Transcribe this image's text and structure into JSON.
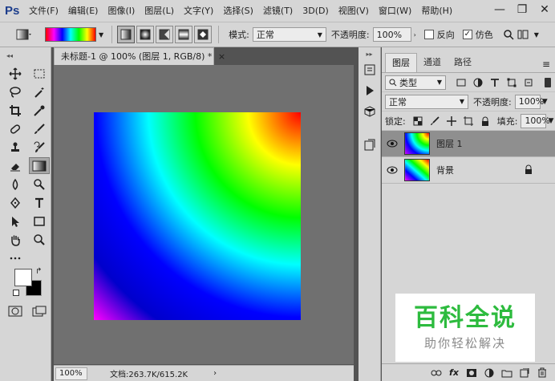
{
  "app": {
    "logo": "Ps"
  },
  "menu": [
    "文件(F)",
    "编辑(E)",
    "图像(I)",
    "图层(L)",
    "文字(Y)",
    "选择(S)",
    "滤镜(T)",
    "3D(D)",
    "视图(V)",
    "窗口(W)",
    "帮助(H)"
  ],
  "window_controls": {
    "minimize": "—",
    "restore": "❐",
    "close": "✕"
  },
  "options": {
    "mode_label": "模式:",
    "mode_value": "正常",
    "opacity_label": "不透明度:",
    "opacity_value": "100%",
    "reverse_label": "反向",
    "reverse_checked": false,
    "dither_label": "仿色",
    "dither_checked": true
  },
  "document": {
    "tab_title": "未标题-1 @ 100% (图层 1, RGB/8) *",
    "close": "×",
    "zoom": "100%",
    "doc_info": "文档:263.7K/615.2K",
    "status_arrow": "›"
  },
  "layers_panel": {
    "tabs": [
      "图层",
      "通道",
      "路径"
    ],
    "active_tab": 0,
    "menu_icon": "≡",
    "filter_label": "类型",
    "blend_mode": "正常",
    "opacity_label": "不透明度:",
    "opacity_value": "100%",
    "lock_label": "锁定:",
    "fill_label": "填充:",
    "fill_value": "100%",
    "layers": [
      {
        "name": "图层 1",
        "selected": true,
        "visible": true,
        "locked": false,
        "thumb": "radial"
      },
      {
        "name": "背景",
        "selected": false,
        "visible": true,
        "locked": true,
        "thumb": "diagonal"
      }
    ],
    "footer_icons": [
      "link-icon",
      "fx-icon",
      "mask-icon",
      "adjustment-icon",
      "group-icon",
      "new-layer-icon",
      "trash-icon"
    ],
    "fx_label": "fx"
  },
  "watermark": {
    "title": "百科全说",
    "subtitle": "助你轻松解决"
  },
  "colors": {
    "foreground": "#ffffff",
    "background": "#000000",
    "accent_green": "#2dbb3e",
    "ps_blue": "#1d3e8c"
  }
}
